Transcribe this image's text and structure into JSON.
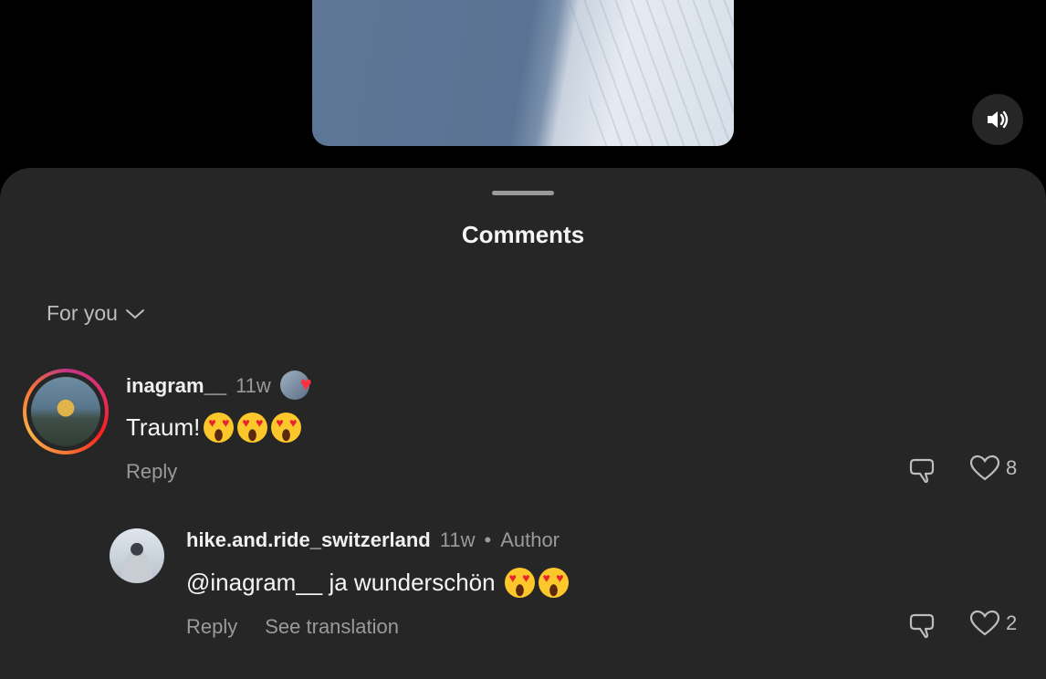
{
  "video": {
    "sound_icon": "speaker-icon"
  },
  "sheet": {
    "title": "Comments",
    "filter_label": "For you",
    "filter_icon": "chevron-down-icon"
  },
  "comments": [
    {
      "username": "inagram__",
      "time": "11w",
      "text": "Traum!",
      "emoji_count": 3,
      "reply_label": "Reply",
      "like_count": "8",
      "liked_by_author": true
    },
    {
      "username": "hike.and.ride_switzerland",
      "time": "11w",
      "separator": "•",
      "author_badge": "Author",
      "text": "@inagram__ ja wunderschön",
      "emoji_count": 2,
      "reply_label": "Reply",
      "translation_label": "See translation",
      "like_count": "2"
    }
  ],
  "colors": {
    "sheet_bg": "#262626",
    "like_heart": "#ff3040",
    "muted_text": "#9a9a9a"
  }
}
